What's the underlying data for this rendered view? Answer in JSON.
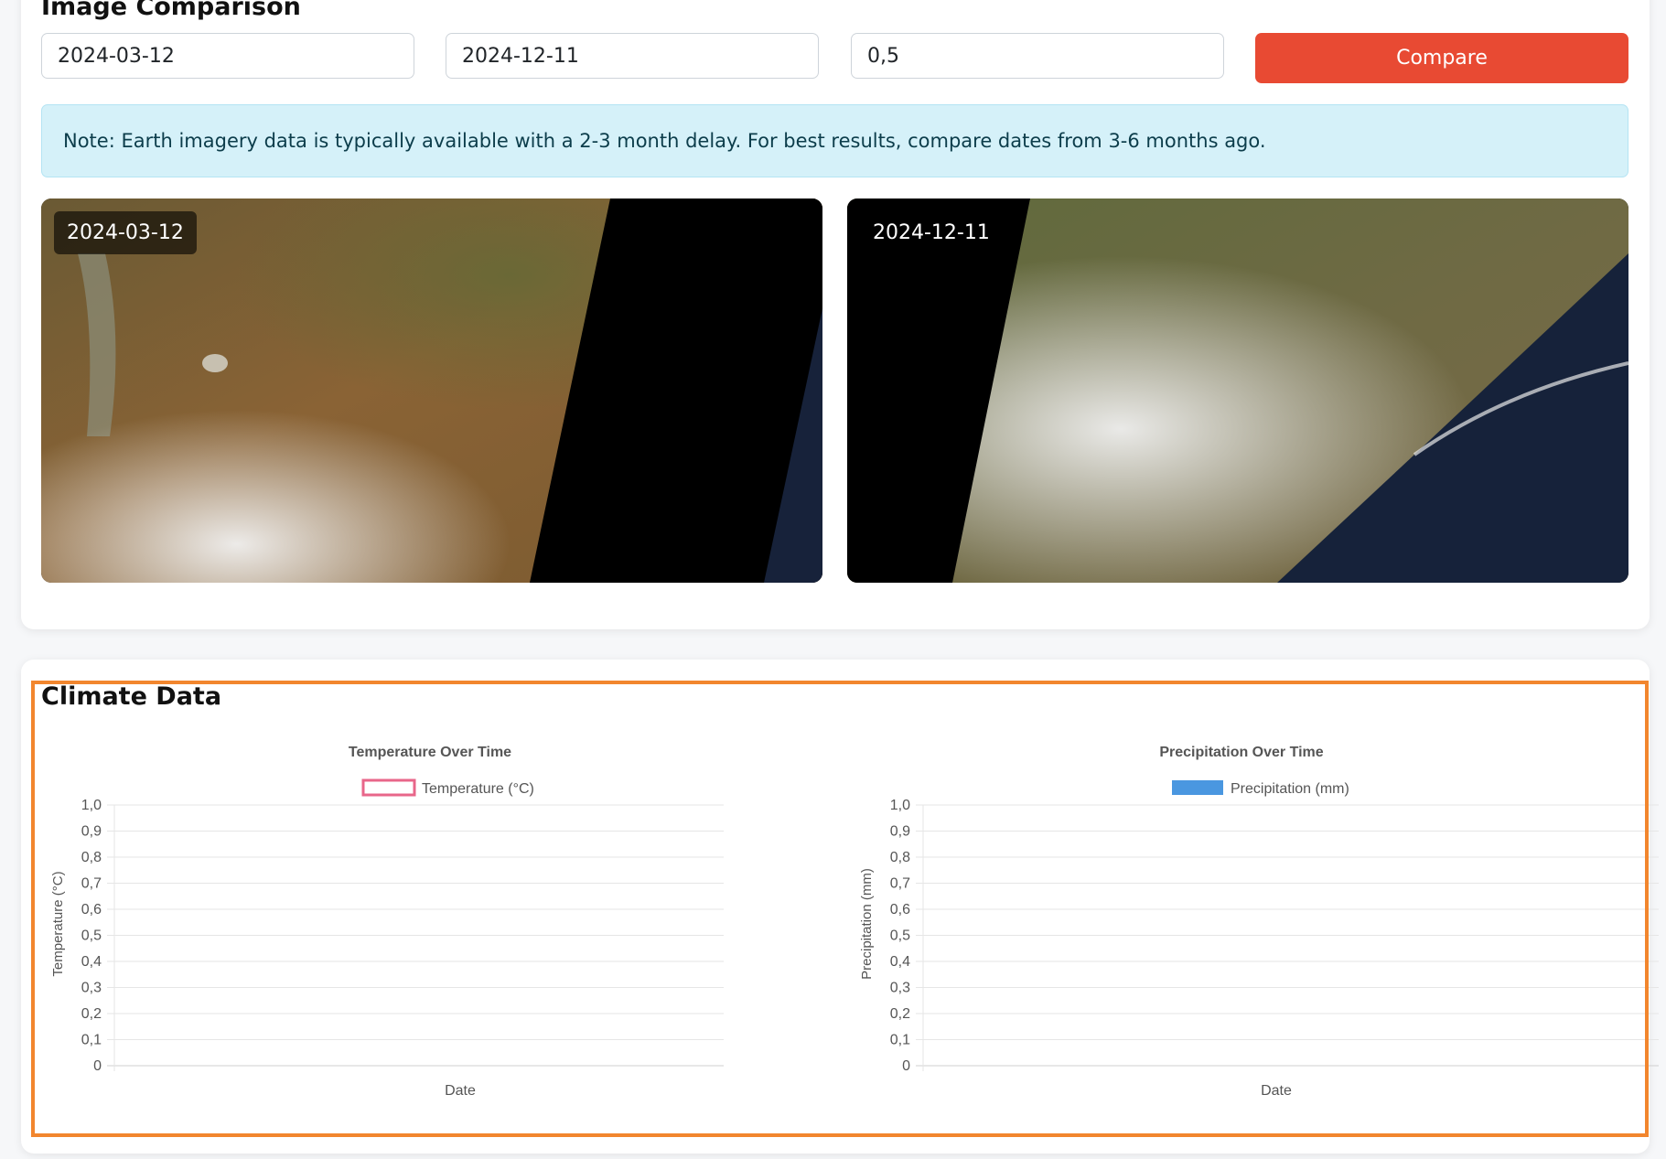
{
  "comparison": {
    "title": "Image Comparison",
    "start_date": "2024-03-12",
    "end_date": "2024-12-11",
    "cloud_value": "0,5",
    "compare_label": "Compare",
    "note": "Note: Earth imagery data is typically available with a 2-3 month delay. For best results, compare dates from 3-6 months ago.",
    "images": [
      {
        "date_label": "2024-03-12"
      },
      {
        "date_label": "2024-12-11"
      }
    ]
  },
  "climate": {
    "title": "Climate Data"
  },
  "colors": {
    "accent": "#e84a33",
    "alert_bg": "#d5f1f9",
    "highlight": "#f2862e",
    "temperature": "#e8668a",
    "precipitation": "#4a97e0"
  },
  "chart_data": [
    {
      "type": "line",
      "title": "Temperature Over Time",
      "xlabel": "Date",
      "ylabel": "Temperature (°C)",
      "series": [
        {
          "name": "Temperature (°C)",
          "values": []
        }
      ],
      "categories": [],
      "ylim": [
        0,
        1.0
      ],
      "yticks": [
        "0",
        "0,1",
        "0,2",
        "0,3",
        "0,4",
        "0,5",
        "0,6",
        "0,7",
        "0,8",
        "0,9",
        "1,0"
      ],
      "grid": true,
      "legend": "top-center"
    },
    {
      "type": "bar",
      "title": "Precipitation Over Time",
      "xlabel": "Date",
      "ylabel": "Precipitation (mm)",
      "series": [
        {
          "name": "Precipitation (mm)",
          "values": []
        }
      ],
      "categories": [],
      "ylim": [
        0,
        1.0
      ],
      "yticks": [
        "0",
        "0,1",
        "0,2",
        "0,3",
        "0,4",
        "0,5",
        "0,6",
        "0,7",
        "0,8",
        "0,9",
        "1,0"
      ],
      "grid": true,
      "legend": "top-center"
    }
  ]
}
